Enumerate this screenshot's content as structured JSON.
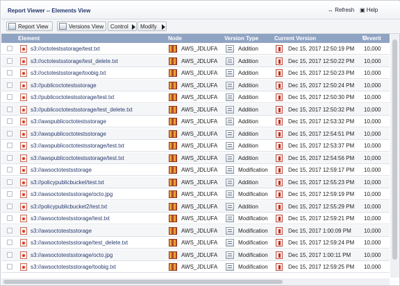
{
  "window": {
    "title": "Report Viewer -- Elements View",
    "refresh_label": "Refresh",
    "help_label": "Help"
  },
  "toolbar": {
    "report_view_label": "Report View",
    "versions_view_label": "Versions View",
    "control_label": "Control",
    "modify_label": "Modify"
  },
  "table": {
    "columns": {
      "element": "Element",
      "node": "Node",
      "version_type": "Version Type",
      "current_version": "Current Version",
      "severity": "Severit"
    },
    "rows": [
      {
        "element": "s3://octotestsstorage/test.txt",
        "node": "AWS_JDLUFA",
        "type": "Addition",
        "version": "Dec 15, 2017 12:50:19 PM",
        "severity": "10,000"
      },
      {
        "element": "s3://octotestsstorage/test_delete.txt",
        "node": "AWS_JDLUFA",
        "type": "Addition",
        "version": "Dec 15, 2017 12:50:22 PM",
        "severity": "10,000"
      },
      {
        "element": "s3://octotestsstorage/toobig.txt",
        "node": "AWS_JDLUFA",
        "type": "Addition",
        "version": "Dec 15, 2017 12:50:23 PM",
        "severity": "10,000"
      },
      {
        "element": "s3://publicoctotestsstorage",
        "node": "AWS_JDLUFA",
        "type": "Addition",
        "version": "Dec 15, 2017 12:50:24 PM",
        "severity": "10,000"
      },
      {
        "element": "s3://publicoctotestsstorage/test.txt",
        "node": "AWS_JDLUFA",
        "type": "Addition",
        "version": "Dec 15, 2017 12:50:30 PM",
        "severity": "10,000"
      },
      {
        "element": "s3://publicoctotestsstorage/test_delete.txt",
        "node": "AWS_JDLUFA",
        "type": "Addition",
        "version": "Dec 15, 2017 12:50:32 PM",
        "severity": "10,000"
      },
      {
        "element": "s3://awspublicoctotestsstorage",
        "node": "AWS_JDLUFA",
        "type": "Addition",
        "version": "Dec 15, 2017 12:53:32 PM",
        "severity": "10,000"
      },
      {
        "element": "s3://awspublicoctotestsstorage",
        "node": "AWS_JDLUFA",
        "type": "Addition",
        "version": "Dec 15, 2017 12:54:51 PM",
        "severity": "10,000"
      },
      {
        "element": "s3://awspublicoctotestsstorage/test.txt",
        "node": "AWS_JDLUFA",
        "type": "Addition",
        "version": "Dec 15, 2017 12:53:37 PM",
        "severity": "10,000"
      },
      {
        "element": "s3://awspublicoctotestsstorage/test.txt",
        "node": "AWS_JDLUFA",
        "type": "Addition",
        "version": "Dec 15, 2017 12:54:56 PM",
        "severity": "10,000"
      },
      {
        "element": "s3://awsoctotestsstorage",
        "node": "AWS_JDLUFA",
        "type": "Modification",
        "version": "Dec 15, 2017 12:59:17 PM",
        "severity": "10,000"
      },
      {
        "element": "s3://policypublicbucket/test.txt",
        "node": "AWS_JDLUFA",
        "type": "Addition",
        "version": "Dec 15, 2017 12:55:23 PM",
        "severity": "10,000"
      },
      {
        "element": "s3://awsoctotestsstorage/octo.jpg",
        "node": "AWS_JDLUFA",
        "type": "Modification",
        "version": "Dec 15, 2017 12:59:19 PM",
        "severity": "10,000"
      },
      {
        "element": "s3://policypublicbucket2/test.txt",
        "node": "AWS_JDLUFA",
        "type": "Addition",
        "version": "Dec 15, 2017 12:55:29 PM",
        "severity": "10,000"
      },
      {
        "element": "s3://awsoctotestsstorage/test.txt",
        "node": "AWS_JDLUFA",
        "type": "Modification",
        "version": "Dec 15, 2017 12:59:21 PM",
        "severity": "10,000"
      },
      {
        "element": "s3://awsoctotestsstorage",
        "node": "AWS_JDLUFA",
        "type": "Modification",
        "version": "Dec 15, 2017 1:00:09 PM",
        "severity": "10,000"
      },
      {
        "element": "s3://awsoctotestsstorage/test_delete.txt",
        "node": "AWS_JDLUFA",
        "type": "Modification",
        "version": "Dec 15, 2017 12:59:24 PM",
        "severity": "10,000"
      },
      {
        "element": "s3://awsoctotestsstorage/octo.jpg",
        "node": "AWS_JDLUFA",
        "type": "Modification",
        "version": "Dec 15, 2017 1:00:11 PM",
        "severity": "10,000"
      },
      {
        "element": "s3://awsoctotestsstorage/toobig.txt",
        "node": "AWS_JDLUFA",
        "type": "Modification",
        "version": "Dec 15, 2017 12:59:25 PM",
        "severity": "10,000"
      }
    ]
  },
  "colors": {
    "header_bg": "#8fa3c3",
    "title_text": "#23356b",
    "element_link": "#24386b"
  },
  "icons": {
    "element": "file-alert-icon",
    "node": "node-server-icon",
    "version_type": "document-change-icon",
    "current_version": "version-alert-icon"
  }
}
